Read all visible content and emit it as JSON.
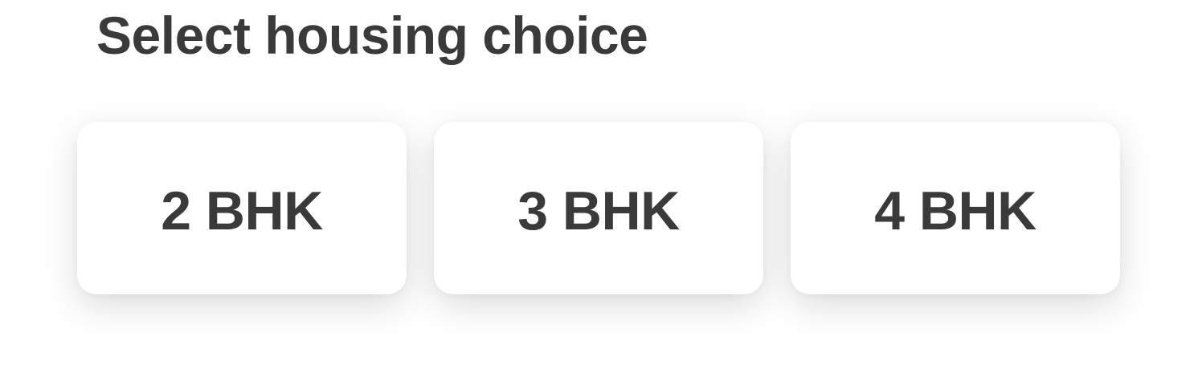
{
  "page": {
    "title": "Select housing choice"
  },
  "options": [
    {
      "label": "2 BHK"
    },
    {
      "label": "3 BHK"
    },
    {
      "label": "4 BHK"
    }
  ],
  "colors": {
    "text": "#3a3a3a",
    "card_background": "#ffffff",
    "page_background": "#ffffff"
  }
}
